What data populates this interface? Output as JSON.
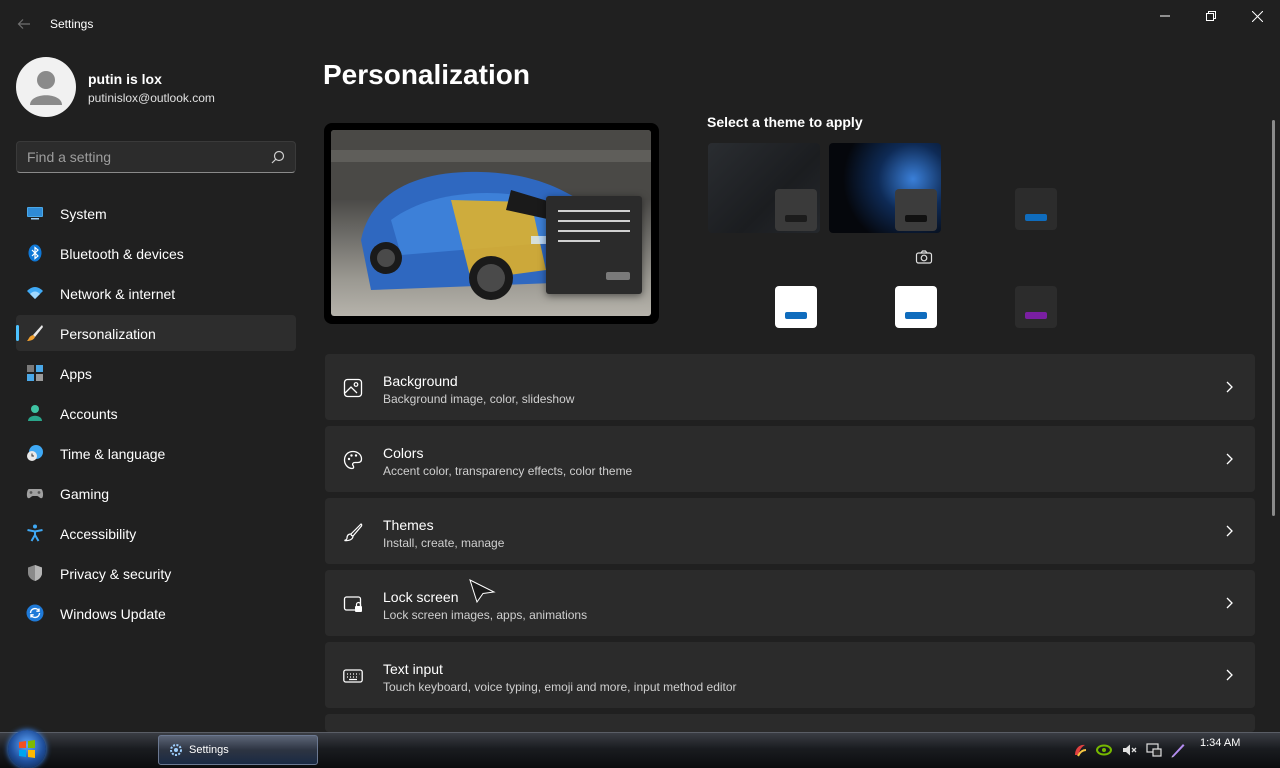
{
  "window": {
    "title": "Settings",
    "back_icon": "back-arrow-icon"
  },
  "profile": {
    "name": "putin is lox",
    "email": "putinislox@outlook.com"
  },
  "search": {
    "placeholder": "Find a setting",
    "value": ""
  },
  "sidebar": {
    "items": [
      {
        "label": "System",
        "icon": "system-icon",
        "active": false
      },
      {
        "label": "Bluetooth & devices",
        "icon": "bluetooth-icon",
        "active": false
      },
      {
        "label": "Network & internet",
        "icon": "wifi-icon",
        "active": false
      },
      {
        "label": "Personalization",
        "icon": "brush-icon",
        "active": true
      },
      {
        "label": "Apps",
        "icon": "apps-icon",
        "active": false
      },
      {
        "label": "Accounts",
        "icon": "accounts-icon",
        "active": false
      },
      {
        "label": "Time & language",
        "icon": "clock-globe-icon",
        "active": false
      },
      {
        "label": "Gaming",
        "icon": "gamepad-icon",
        "active": false
      },
      {
        "label": "Accessibility",
        "icon": "accessibility-icon",
        "active": false
      },
      {
        "label": "Privacy & security",
        "icon": "shield-icon",
        "active": false
      },
      {
        "label": "Windows Update",
        "icon": "update-icon",
        "active": false
      }
    ]
  },
  "main": {
    "title": "Personalization",
    "theme_heading": "Select a theme to apply",
    "cards": [
      {
        "title": "Background",
        "subtitle": "Background image, color, slideshow",
        "icon": "image-icon"
      },
      {
        "title": "Colors",
        "subtitle": "Accent color, transparency effects, color theme",
        "icon": "palette-icon"
      },
      {
        "title": "Themes",
        "subtitle": "Install, create, manage",
        "icon": "brush-icon"
      },
      {
        "title": "Lock screen",
        "subtitle": "Lock screen images, apps, animations",
        "icon": "lock-screen-icon"
      },
      {
        "title": "Text input",
        "subtitle": "Touch keyboard, voice typing, emoji and more, input method editor",
        "icon": "keyboard-icon"
      }
    ]
  },
  "colors": {
    "accent": "#4cc2ff",
    "blue_theme": "#0f6cbd",
    "purple_theme": "#7a1fa2"
  },
  "taskbar": {
    "task_label": "Settings",
    "clock": "1:34 AM"
  }
}
